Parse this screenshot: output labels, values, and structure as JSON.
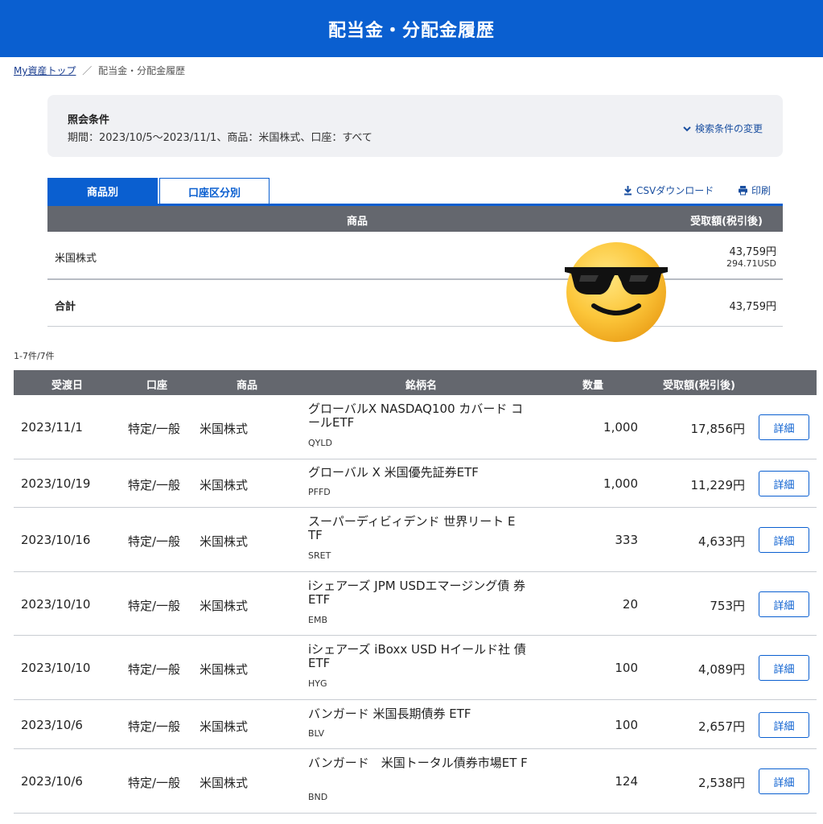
{
  "header": {
    "title": "配当金・分配金履歴"
  },
  "breadcrumb": {
    "home": "My資産トップ",
    "separator": "／",
    "current": "配当金・分配金履歴"
  },
  "conditions": {
    "title": "照会条件",
    "text": "期間：2023/10/5～2023/11/1、商品：米国株式、口座：すべて",
    "change_label": "検索条件の変更"
  },
  "tabs": {
    "active": "商品別",
    "inactive": "口座区分別"
  },
  "tools": {
    "csv": "CSVダウンロード",
    "print": "印刷"
  },
  "summary": {
    "headers": {
      "product": "商品",
      "amount": "受取額(税引後)"
    },
    "row": {
      "name": "米国株式",
      "amount_jpy": "43,759円",
      "amount_usd": "294.71USD"
    },
    "total": {
      "label": "合計",
      "amount": "43,759円"
    }
  },
  "details": {
    "count": "1-7件/7件",
    "headers": {
      "date": "受渡日",
      "account": "口座",
      "product": "商品",
      "name": "銘柄名",
      "qty": "数量",
      "amount": "受取額(税引後)"
    },
    "button_label": "詳細",
    "rows": [
      {
        "date": "2023/11/1",
        "account": "特定/一般",
        "product": "米国株式",
        "name": "グローバルX NASDAQ100 カバード コールETF",
        "ticker": "QYLD",
        "qty": "1,000",
        "amount": "17,856円"
      },
      {
        "date": "2023/10/19",
        "account": "特定/一般",
        "product": "米国株式",
        "name": "グローバル X 米国優先証券ETF",
        "ticker": "PFFD",
        "qty": "1,000",
        "amount": "11,229円"
      },
      {
        "date": "2023/10/16",
        "account": "特定/一般",
        "product": "米国株式",
        "name": "スーパーディビィデンド 世界リート E TF",
        "ticker": "SRET",
        "qty": "333",
        "amount": "4,633円"
      },
      {
        "date": "2023/10/10",
        "account": "特定/一般",
        "product": "米国株式",
        "name": "iシェアーズ JPM USDエマージング債 券 ETF",
        "ticker": "EMB",
        "qty": "20",
        "amount": "753円"
      },
      {
        "date": "2023/10/10",
        "account": "特定/一般",
        "product": "米国株式",
        "name": "iシェアーズ iBoxx USD Hイールド社 債 ETF",
        "ticker": "HYG",
        "qty": "100",
        "amount": "4,089円"
      },
      {
        "date": "2023/10/6",
        "account": "特定/一般",
        "product": "米国株式",
        "name": "バンガード 米国長期債券 ETF",
        "ticker": "BLV",
        "qty": "100",
        "amount": "2,657円"
      },
      {
        "date": "2023/10/6",
        "account": "特定/一般",
        "product": "米国株式",
        "name": "バンガード　米国トータル債券市場ET F",
        "ticker": "BND",
        "qty": "124",
        "amount": "2,538円"
      }
    ]
  },
  "overlay": {
    "icon": "sunglasses-smiley-icon"
  },
  "colors": {
    "brand": "#0a5fd0",
    "table_header": "#64676e",
    "condition_bg": "#f0f1f4"
  }
}
